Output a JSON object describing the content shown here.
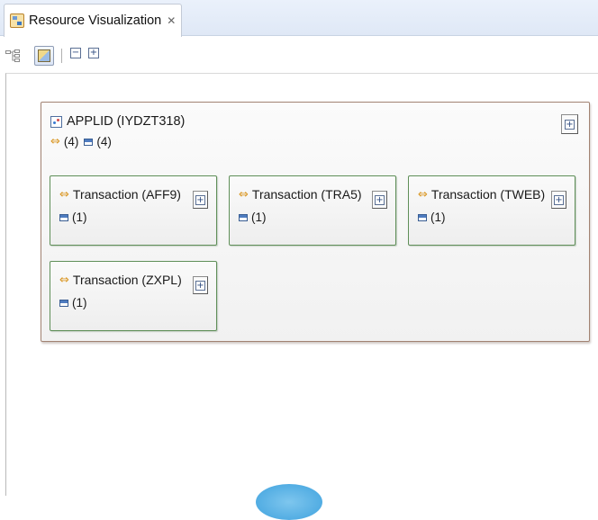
{
  "tab": {
    "title": "Resource Visualization",
    "close_glyph": "✕"
  },
  "toolbar": {
    "buttons": [
      {
        "icon": "tree-layout-icon"
      },
      {
        "icon": "visualization-icon",
        "active": true
      },
      {
        "icon": "collapse-all-icon",
        "glyph": "−"
      },
      {
        "icon": "expand-all-icon",
        "glyph": "+"
      }
    ]
  },
  "applid": {
    "title": "APPLID (IYDZT318)",
    "transaction_count": "(4)",
    "task_count": "(4)",
    "expand_glyph": "+"
  },
  "transactions": [
    {
      "title": "Transaction (AFF9)",
      "task_count": "(1)",
      "expand_glyph": "+"
    },
    {
      "title": "Transaction (TRA5)",
      "task_count": "(1)",
      "expand_glyph": "+"
    },
    {
      "title": "Transaction (TWEB)",
      "task_count": "(1)",
      "expand_glyph": "+"
    },
    {
      "title": "Transaction (ZXPL)",
      "task_count": "(1)",
      "expand_glyph": "+"
    }
  ],
  "icons": {
    "transaction": "⇔",
    "transaction_color": "#d9941e",
    "task_color": "#4f7cc0",
    "applid_border": "#a28373",
    "transaction_border": "#5f8f58"
  }
}
